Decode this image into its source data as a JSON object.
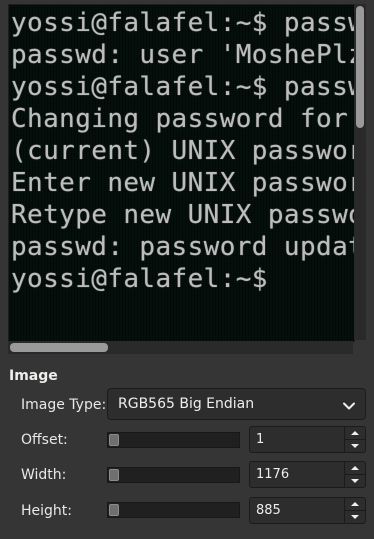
{
  "preview": {
    "lines": [
      "yossi@falafel:~$ passwd MoshePlz",
      "passwd: user 'MoshePlz' does not exist",
      "yossi@falafel:~$ passwd",
      "Changing password for yossi.",
      "(current) UNIX password:",
      "Enter new UNIX password:",
      "Retype new UNIX password:",
      "passwd: password updated successfully",
      "yossi@falafel:~$"
    ]
  },
  "options": {
    "section_title": "Image",
    "image_type": {
      "label": "Image Type:",
      "value": "RGB565 Big Endian",
      "icon": "chevron-down-icon"
    },
    "offset": {
      "label": "Offset:",
      "value": "1",
      "slider_fraction": 0.0
    },
    "width": {
      "label": "Width:",
      "value": "1176",
      "slider_fraction": 0.0
    },
    "height": {
      "label": "Height:",
      "value": "885",
      "slider_fraction": 0.0
    }
  },
  "colors": {
    "background": "#353535",
    "terminal_bg": "#06110d",
    "terminal_text": "#bdbdbd"
  }
}
